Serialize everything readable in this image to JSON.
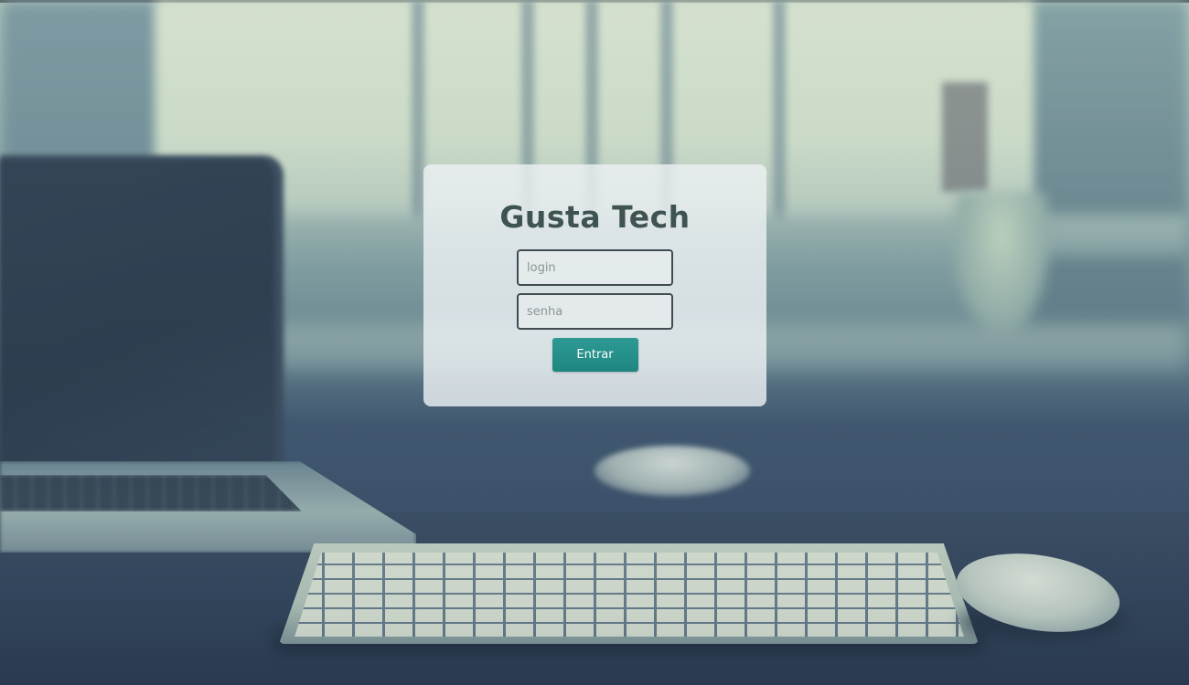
{
  "login_card": {
    "brand_title": "Gusta Tech",
    "login_field": {
      "placeholder": "login",
      "value": ""
    },
    "password_field": {
      "placeholder": "senha",
      "value": ""
    },
    "submit_label": "Entrar"
  },
  "colors": {
    "brand_text": "#3f5452",
    "button_bg": "#239089",
    "button_text": "#ffffff",
    "field_border": "#3f4d52"
  }
}
